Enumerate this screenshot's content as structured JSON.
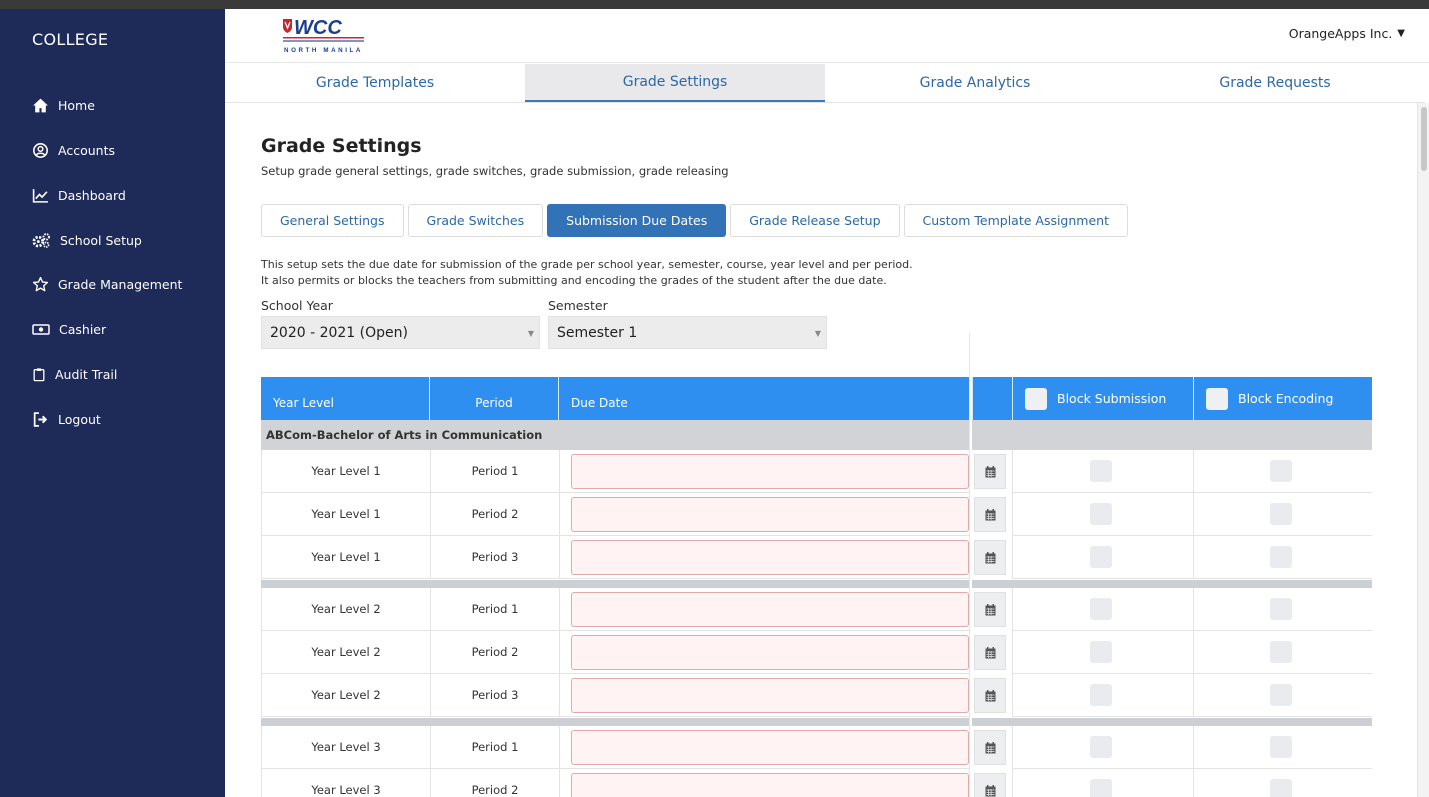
{
  "sidebar": {
    "brand": "COLLEGE",
    "items": [
      {
        "label": "Home",
        "icon": "home-icon"
      },
      {
        "label": "Accounts",
        "icon": "user-circle-icon"
      },
      {
        "label": "Dashboard",
        "icon": "line-chart-icon"
      },
      {
        "label": "School Setup",
        "icon": "gears-icon"
      },
      {
        "label": "Grade Management",
        "icon": "star-icon"
      },
      {
        "label": "Cashier",
        "icon": "money-icon"
      },
      {
        "label": "Audit Trail",
        "icon": "clipboard-icon"
      },
      {
        "label": "Logout",
        "icon": "logout-icon"
      }
    ]
  },
  "header": {
    "logo": {
      "text": "WCC",
      "subtitle": "NORTH MANILA"
    },
    "user": "OrangeApps Inc."
  },
  "top_tabs": [
    "Grade Templates",
    "Grade Settings",
    "Grade Analytics",
    "Grade Requests"
  ],
  "active_top_tab": "Grade Settings",
  "page": {
    "title": "Grade Settings",
    "subtitle": "Setup grade general settings, grade switches, grade submission, grade releasing"
  },
  "sub_tabs": [
    "General Settings",
    "Grade Switches",
    "Submission Due Dates",
    "Grade Release Setup",
    "Custom Template Assignment"
  ],
  "active_sub_tab": "Submission Due Dates",
  "description": {
    "line1": "This setup sets the due date for submission of the grade per school year, semester, course, year level and per period.",
    "line2": "It also permits or blocks the teachers from submitting and encoding the grades of the student after the due date."
  },
  "filters": {
    "school_year": {
      "label": "School Year",
      "value": "2020 - 2021 (Open)"
    },
    "semester": {
      "label": "Semester",
      "value": "Semester 1"
    }
  },
  "table": {
    "headers": {
      "year_level": "Year Level",
      "period": "Period",
      "due_date": "Due Date",
      "block_submission": "Block Submission",
      "block_encoding": "Block Encoding"
    },
    "group": "ABCom-Bachelor of Arts in Communication",
    "rows": [
      {
        "year_level": "Year Level 1",
        "period": "Period 1",
        "due_date": ""
      },
      {
        "year_level": "Year Level 1",
        "period": "Period 2",
        "due_date": ""
      },
      {
        "year_level": "Year Level 1",
        "period": "Period 3",
        "due_date": ""
      },
      {
        "year_level": "Year Level 2",
        "period": "Period 1",
        "due_date": ""
      },
      {
        "year_level": "Year Level 2",
        "period": "Period 2",
        "due_date": ""
      },
      {
        "year_level": "Year Level 2",
        "period": "Period 3",
        "due_date": ""
      },
      {
        "year_level": "Year Level 3",
        "period": "Period 1",
        "due_date": ""
      },
      {
        "year_level": "Year Level 3",
        "period": "Period 2",
        "due_date": ""
      }
    ]
  },
  "colors": {
    "sidebar": "#1e2a58",
    "accent": "#2f8ff0",
    "active_tab": "#3272b6",
    "invalid_input": "#fff4f3"
  }
}
